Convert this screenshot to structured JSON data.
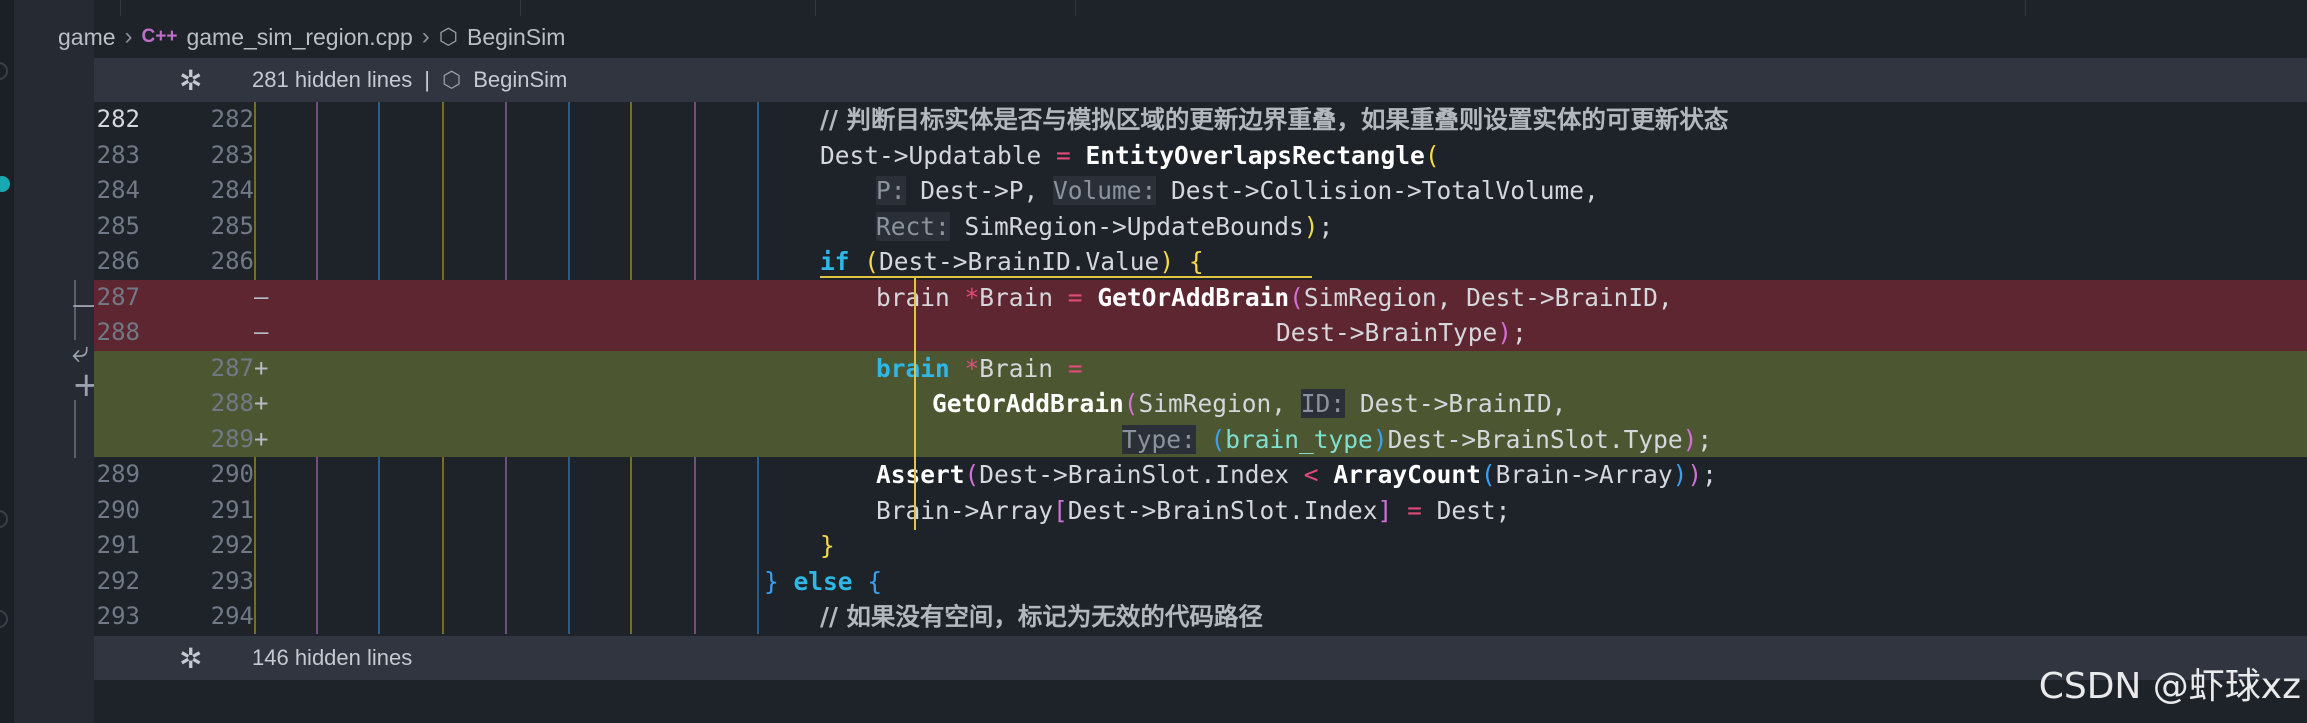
{
  "breadcrumb": {
    "folder": "game",
    "file_icon": "C++",
    "file": "game_sim_region.cpp",
    "symbol": "BeginSim"
  },
  "fold_top": {
    "text": "281 hidden lines",
    "sep": "|",
    "symbol": "BeginSim"
  },
  "fold_bottom": {
    "text": "146 hidden lines"
  },
  "gutter": {
    "minus": "—",
    "revert": "⤶",
    "plus": "+"
  },
  "lines": [
    {
      "a": "282",
      "b": "282",
      "m": "",
      "t": "// 判断目标实体是否与模拟区域的更新边界重叠，如果重叠则设置实体的可更新状态"
    },
    {
      "a": "283",
      "b": "283",
      "m": "",
      "t": "Dest->Updatable = EntityOverlapsRectangle("
    },
    {
      "a": "284",
      "b": "284",
      "m": "",
      "t": "P: Dest->P, Volume: Dest->Collision->TotalVolume,"
    },
    {
      "a": "285",
      "b": "285",
      "m": "",
      "t": "Rect: SimRegion->UpdateBounds);"
    },
    {
      "a": "286",
      "b": "286",
      "m": "",
      "t": "if (Dest->BrainID.Value) {"
    },
    {
      "a": "287",
      "b": "",
      "m": "—",
      "t": "brain *Brain = GetOrAddBrain(SimRegion, Dest->BrainID,"
    },
    {
      "a": "288",
      "b": "",
      "m": "—",
      "t": "Dest->BrainType);"
    },
    {
      "a": "",
      "b": "287",
      "m": "+",
      "t": "brain *Brain ="
    },
    {
      "a": "",
      "b": "288",
      "m": "+",
      "t": "GetOrAddBrain(SimRegion, ID: Dest->BrainID,"
    },
    {
      "a": "",
      "b": "289",
      "m": "+",
      "t": "Type: (brain_type)Dest->BrainSlot.Type);"
    },
    {
      "a": "289",
      "b": "290",
      "m": "",
      "t": "Assert(Dest->BrainSlot.Index < ArrayCount(Brain->Array));"
    },
    {
      "a": "290",
      "b": "291",
      "m": "",
      "t": "Brain->Array[Dest->BrainSlot.Index] = Dest;"
    },
    {
      "a": "291",
      "b": "292",
      "m": "",
      "t": "}"
    },
    {
      "a": "292",
      "b": "293",
      "m": "",
      "t": "} else {"
    },
    {
      "a": "293",
      "b": "294",
      "m": "",
      "t": "// 如果没有空间，标记为无效的代码路径"
    }
  ],
  "tokens": {
    "l0": [
      "// 判断目标实体是否与模拟区域的更新边界重叠，如果重叠则设置实体的可更新状态"
    ],
    "l1": [
      "Dest->Updatable ",
      "=",
      " ",
      "EntityOverlapsRectangle",
      "("
    ],
    "l2": [
      "P:",
      " Dest->P, ",
      "Volume:",
      " Dest->Collision->TotalVolume,"
    ],
    "l3": [
      "Rect:",
      " SimRegion->UpdateBounds",
      ")",
      ";"
    ],
    "l4": [
      "if",
      " ",
      "(",
      "Dest->BrainID.Value",
      ")",
      " ",
      "{"
    ],
    "l5": [
      "brain ",
      "*",
      "Brain ",
      "=",
      " ",
      "GetOrAddBrain",
      "(",
      "SimRegion, Dest->BrainID,"
    ],
    "l6": [
      "Dest->BrainType",
      ")",
      ";"
    ],
    "l7": [
      "brain",
      " ",
      "*",
      "Brain ",
      "="
    ],
    "l8": [
      "GetOrAddBrain",
      "(",
      "SimRegion, ",
      "ID:",
      " Dest->BrainID,"
    ],
    "l9": [
      "Type:",
      " ",
      "(",
      "brain_type",
      ")",
      "Dest->BrainSlot.Type",
      ")",
      ";"
    ],
    "l10": [
      "Assert",
      "(",
      "Dest->BrainSlot.Index ",
      "<",
      " ",
      "ArrayCount",
      "(",
      "Brain->Array",
      ")",
      ")",
      ";"
    ],
    "l11": [
      "Brain->Array",
      "[",
      "Dest->BrainSlot.Index",
      "]",
      " ",
      "=",
      " Dest;"
    ],
    "l12": [
      "}"
    ],
    "l13": [
      "}",
      " ",
      "else",
      " ",
      "{"
    ],
    "l14": [
      "// 如果没有空间，标记为无效的代码路径"
    ]
  },
  "watermark": "CSDN @虾球xz",
  "colors": {
    "background": "#1e2229",
    "deleted_line": "#5e2631",
    "added_line": "#4c5630",
    "keyword": "#2fb7e6",
    "bracket_scope": "#e0c542"
  }
}
